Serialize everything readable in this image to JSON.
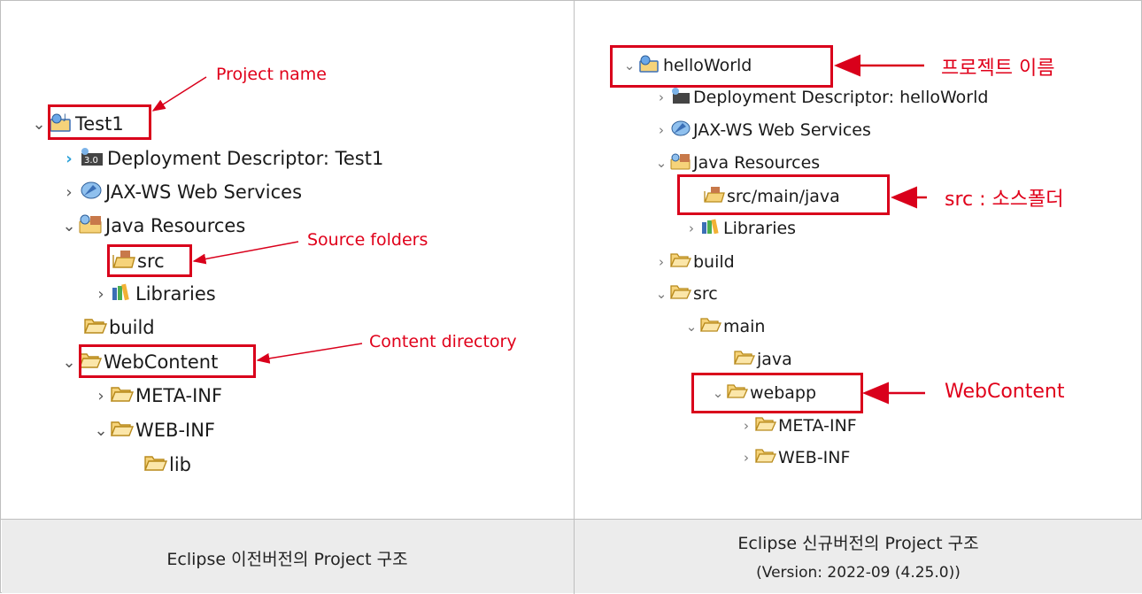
{
  "left": {
    "project": "Test1",
    "nodes": {
      "deployment": "Deployment Descriptor: Test1",
      "jaxws": "JAX-WS Web Services",
      "java_resources": "Java Resources",
      "src": "src",
      "libraries": "Libraries",
      "build": "build",
      "webcontent": "WebContent",
      "meta_inf": "META-INF",
      "web_inf": "WEB-INF",
      "lib": "lib"
    },
    "annotations": {
      "project_name": "Project name",
      "source_folders": "Source folders",
      "content_directory": "Content directory"
    },
    "badge": "3.0",
    "caption": "Eclipse 이전버전의 Project 구조"
  },
  "right": {
    "project": "helloWorld",
    "nodes": {
      "deployment": "Deployment Descriptor: helloWorld",
      "jaxws": "JAX-WS Web Services",
      "java_resources": "Java Resources",
      "src_main_java": "src/main/java",
      "libraries": "Libraries",
      "build": "build",
      "src": "src",
      "main": "main",
      "java": "java",
      "webapp": "webapp",
      "meta_inf": "META-INF",
      "web_inf": "WEB-INF"
    },
    "annotations": {
      "project_name": "프로젝트 이름",
      "source_folder": "src : 소스폴더",
      "webcontent": "WebContent"
    },
    "caption_line1": "Eclipse 신규버전의 Project 구조",
    "caption_line2": "(Version: 2022-09 (4.25.0))"
  },
  "colors": {
    "annotation_red": "#d9001b",
    "expand_arrow_blue": "#2aa0d8",
    "folder": "#f6d37a"
  },
  "icons": [
    "project-icon",
    "deployment-descriptor-icon",
    "web-services-icon",
    "java-resources-icon",
    "package-folder-icon",
    "libraries-icon",
    "folder-icon"
  ]
}
